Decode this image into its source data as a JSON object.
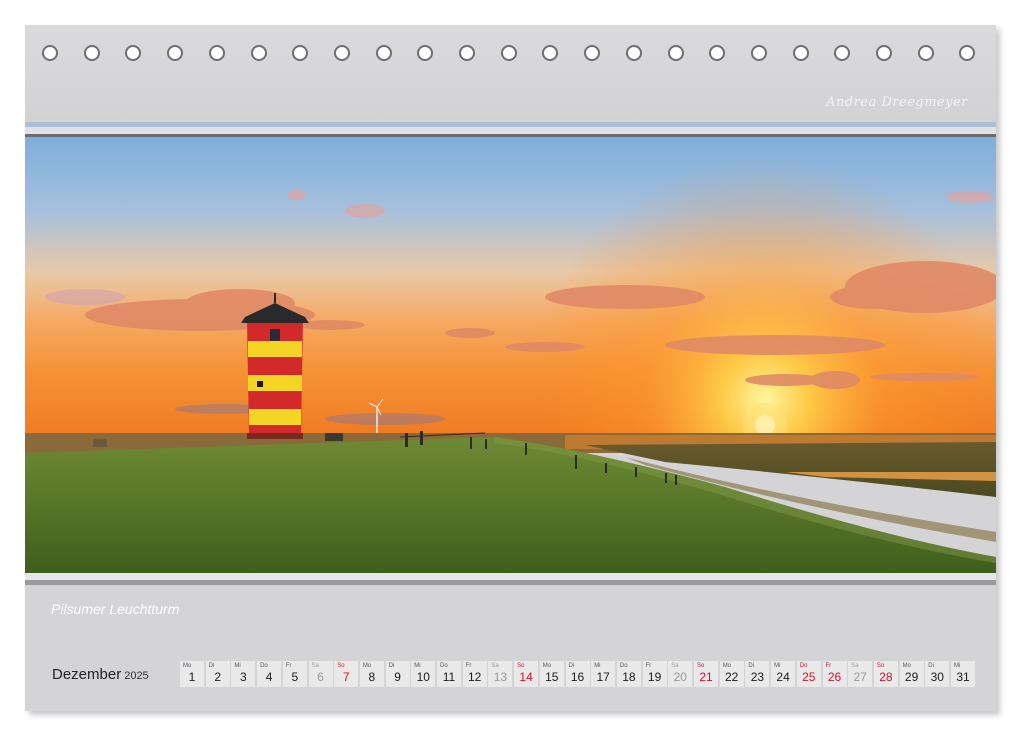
{
  "author": "Andrea Dreegmeyer",
  "caption": "Pilsumer Leuchtturm",
  "calendar": {
    "month": "Dezember",
    "year": "2025",
    "days": [
      {
        "wd": "Mo",
        "n": "1",
        "t": "n"
      },
      {
        "wd": "Di",
        "n": "2",
        "t": "n"
      },
      {
        "wd": "Mi",
        "n": "3",
        "t": "n"
      },
      {
        "wd": "Do",
        "n": "4",
        "t": "n"
      },
      {
        "wd": "Fr",
        "n": "5",
        "t": "n"
      },
      {
        "wd": "Sa",
        "n": "6",
        "t": "s"
      },
      {
        "wd": "So",
        "n": "7",
        "t": "r"
      },
      {
        "wd": "Mo",
        "n": "8",
        "t": "n"
      },
      {
        "wd": "Di",
        "n": "9",
        "t": "n"
      },
      {
        "wd": "Mi",
        "n": "10",
        "t": "n"
      },
      {
        "wd": "Do",
        "n": "11",
        "t": "n"
      },
      {
        "wd": "Fr",
        "n": "12",
        "t": "n"
      },
      {
        "wd": "Sa",
        "n": "13",
        "t": "s"
      },
      {
        "wd": "So",
        "n": "14",
        "t": "r"
      },
      {
        "wd": "Mo",
        "n": "15",
        "t": "n"
      },
      {
        "wd": "Di",
        "n": "16",
        "t": "n"
      },
      {
        "wd": "Mi",
        "n": "17",
        "t": "n"
      },
      {
        "wd": "Do",
        "n": "18",
        "t": "n"
      },
      {
        "wd": "Fr",
        "n": "19",
        "t": "n"
      },
      {
        "wd": "Sa",
        "n": "20",
        "t": "s"
      },
      {
        "wd": "So",
        "n": "21",
        "t": "r"
      },
      {
        "wd": "Mo",
        "n": "22",
        "t": "n"
      },
      {
        "wd": "Di",
        "n": "23",
        "t": "n"
      },
      {
        "wd": "Mi",
        "n": "24",
        "t": "n"
      },
      {
        "wd": "Do",
        "n": "25",
        "t": "r"
      },
      {
        "wd": "Fr",
        "n": "26",
        "t": "r"
      },
      {
        "wd": "Sa",
        "n": "27",
        "t": "s"
      },
      {
        "wd": "So",
        "n": "28",
        "t": "r"
      },
      {
        "wd": "Mo",
        "n": "29",
        "t": "n"
      },
      {
        "wd": "Di",
        "n": "30",
        "t": "n"
      },
      {
        "wd": "Mi",
        "n": "31",
        "t": "n"
      }
    ]
  },
  "colors": {
    "weekday": "#1b1b1b",
    "saturday": "#9a9a9a",
    "holiday": "#d0142c"
  }
}
